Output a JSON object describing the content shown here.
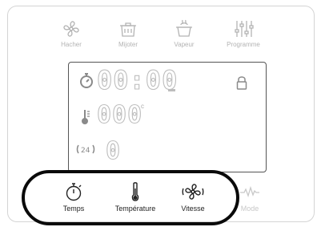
{
  "modes": [
    {
      "label": "Hacher",
      "icon": "blade-icon"
    },
    {
      "label": "Mijoter",
      "icon": "pot-icon"
    },
    {
      "label": "Vapeur",
      "icon": "steam-basket-icon"
    },
    {
      "label": "Programme",
      "icon": "sliders-icon"
    }
  ],
  "display": {
    "time": "00:00",
    "temperature": "000",
    "temperature_unit": "c",
    "speed": "0"
  },
  "controls": [
    {
      "label": "Temps",
      "icon": "timer-icon"
    },
    {
      "label": "Température",
      "icon": "thermometer-icon"
    },
    {
      "label": "Vitesse",
      "icon": "fan-icon"
    },
    {
      "label": "Mode",
      "icon": "wave-icon"
    }
  ],
  "colors": {
    "inactive": "#b3b3b3",
    "active": "#222222",
    "highlight_ring": "#0a0a0a"
  }
}
